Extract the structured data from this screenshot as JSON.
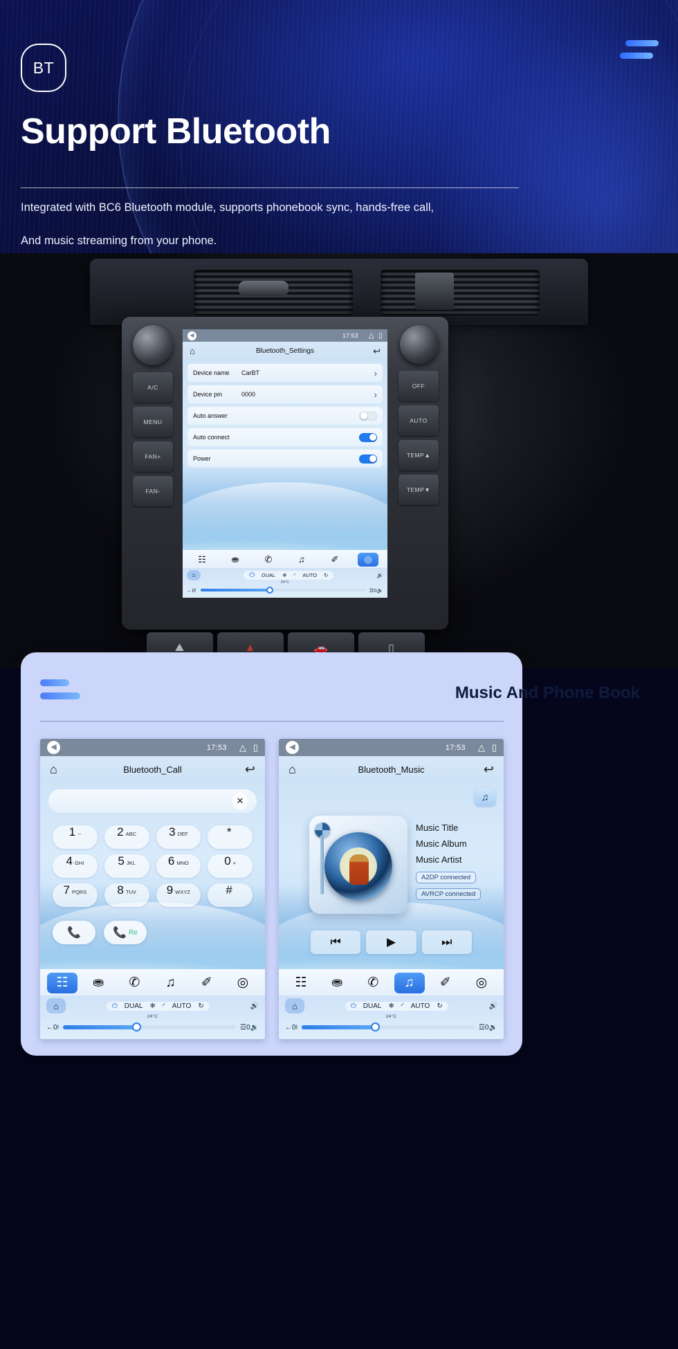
{
  "hero": {
    "badge": "BT",
    "title": "Support Bluetooth",
    "line1": "Integrated with BC6 Bluetooth module, supports phonebook sync, hands-free call,",
    "line2": "And music streaming from your phone.",
    "menu_icon": "hamburger-icon"
  },
  "car": {
    "side_buttons_left": [
      "A/C",
      "MENU",
      "FAN+",
      "FAN-"
    ],
    "side_buttons_right": [
      "OFF",
      "AUTO",
      "TEMP▲",
      "TEMP▼"
    ],
    "console_buttons": [
      "defrost-icon",
      "hazard-icon",
      "rear-defrost-icon",
      "eject-icon"
    ]
  },
  "settings_screen": {
    "status": {
      "back_icon": "back-triangle-icon",
      "clock": "17:53",
      "up_icon": "chevron-up-icon",
      "recents_icon": "recents-icon"
    },
    "home_icon": "home-icon",
    "title": "Bluetooth_Settings",
    "return_icon": "return-arrow-icon",
    "rows": [
      {
        "label": "Device name",
        "value": "CarBT",
        "type": "chevron"
      },
      {
        "label": "Device pin",
        "value": "0000",
        "type": "chevron"
      },
      {
        "label": "Auto answer",
        "value": "",
        "type": "toggle",
        "on": false
      },
      {
        "label": "Auto connect",
        "value": "",
        "type": "toggle",
        "on": true
      },
      {
        "label": "Power",
        "value": "",
        "type": "toggle",
        "on": true
      }
    ],
    "nav": [
      "apps-grid-icon",
      "contact-icon",
      "phone-icon",
      "music-note-icon",
      "link-icon",
      "settings-gear-icon"
    ],
    "nav_active": 5,
    "climate": {
      "home_icon": "home-icon",
      "power_icon": "power-icon",
      "dual": "DUAL",
      "snow_icon": "snowflake-icon",
      "windshield_icon": "windshield-defrost-icon",
      "auto": "AUTO",
      "recirc_icon": "recirculate-icon",
      "vol_up_icon": "volume-up-icon",
      "vol_down_icon": "volume-down-icon",
      "temp": "24°C",
      "back_icon": "back-arrow-icon",
      "left_value": "0",
      "right_value": "0",
      "seat_left_icon": "seat-icon",
      "seat_right_icon": "seat-heat-icon"
    }
  },
  "card": {
    "title": "Music And Phone Book",
    "mark_icon": "accent-bars-icon"
  },
  "call_screen": {
    "status": {
      "back_icon": "back-triangle-icon",
      "clock": "17:53",
      "up_icon": "chevron-up-icon",
      "recents_icon": "recents-icon"
    },
    "home_icon": "home-icon",
    "title": "Bluetooth_Call",
    "return_icon": "return-arrow-icon",
    "input_value": "",
    "clear_icon": "clear-x-icon",
    "keys": [
      {
        "num": "1",
        "sub": "--"
      },
      {
        "num": "2",
        "sub": "ABC"
      },
      {
        "num": "3",
        "sub": "DEF"
      },
      {
        "num": "*",
        "sub": ""
      },
      {
        "num": "4",
        "sub": "GHI"
      },
      {
        "num": "5",
        "sub": "JKL"
      },
      {
        "num": "6",
        "sub": "MNO"
      },
      {
        "num": "0",
        "sub": "+"
      },
      {
        "num": "7",
        "sub": "PQRS"
      },
      {
        "num": "8",
        "sub": "TUV"
      },
      {
        "num": "9",
        "sub": "WXYZ"
      },
      {
        "num": "#",
        "sub": ""
      }
    ],
    "dial_icon": "phone-dial-icon",
    "redial_label": "Re",
    "nav": [
      "apps-grid-icon",
      "contact-icon",
      "phone-icon",
      "music-note-icon",
      "link-icon",
      "settings-gear-icon"
    ],
    "nav_active": 0,
    "climate": {
      "home_icon": "home-icon",
      "power_icon": "power-icon",
      "dual": "DUAL",
      "snow_icon": "snowflake-icon",
      "windshield_icon": "windshield-defrost-icon",
      "auto": "AUTO",
      "recirc_icon": "recirculate-icon",
      "vol_up_icon": "volume-up-icon",
      "vol_down_icon": "volume-down-icon",
      "temp": "24°C",
      "back_icon": "back-arrow-icon",
      "left_value": "0",
      "right_value": "0",
      "seat_left_icon": "seat-icon",
      "seat_right_icon": "seat-heat-icon"
    }
  },
  "music_screen": {
    "status": {
      "back_icon": "back-triangle-icon",
      "clock": "17:53",
      "up_icon": "chevron-up-icon",
      "recents_icon": "recents-icon"
    },
    "home_icon": "home-icon",
    "title": "Bluetooth_Music",
    "return_icon": "return-arrow-icon",
    "note_button_icon": "music-note-icon",
    "meta": {
      "title": "Music Title",
      "album": "Music Album",
      "artist": "Music Artist"
    },
    "badges": [
      "A2DP  connected",
      "AVRCP connected"
    ],
    "controls": [
      "prev-track-icon",
      "play-icon",
      "next-track-icon"
    ],
    "nav": [
      "apps-grid-icon",
      "contact-icon",
      "phone-icon",
      "music-note-icon",
      "link-icon",
      "settings-gear-icon"
    ],
    "nav_active": 3,
    "climate": {
      "home_icon": "home-icon",
      "power_icon": "power-icon",
      "dual": "DUAL",
      "snow_icon": "snowflake-icon",
      "windshield_icon": "windshield-defrost-icon",
      "auto": "AUTO",
      "recirc_icon": "recirculate-icon",
      "vol_up_icon": "volume-up-icon",
      "vol_down_icon": "volume-down-icon",
      "temp": "24°C",
      "back_icon": "back-arrow-icon",
      "left_value": "0",
      "right_value": "0",
      "seat_left_icon": "seat-icon",
      "seat_right_icon": "seat-heat-icon"
    }
  },
  "colors": {
    "accent": "#2f6bff",
    "accent_light": "#79b9fb",
    "hero_bg": "#0a0f3e",
    "card_bg": "#ccd6fb",
    "toggle_on": "#1f7bf0",
    "status_bar": "#7a8a9c"
  }
}
